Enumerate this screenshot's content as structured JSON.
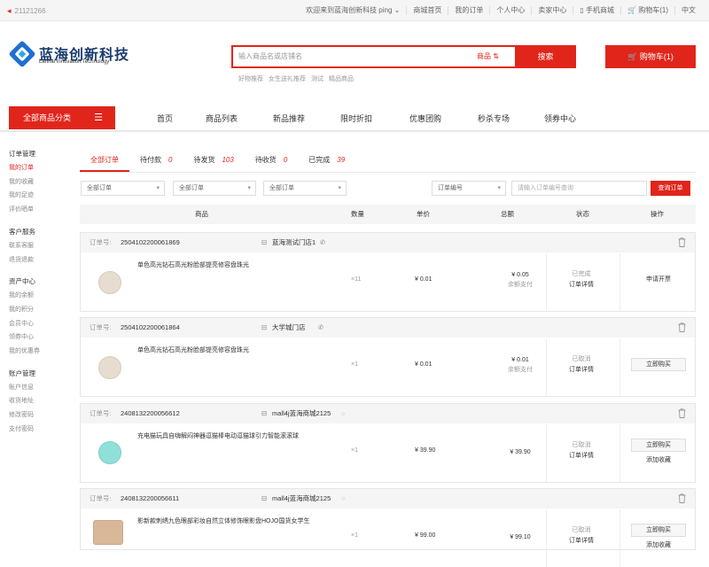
{
  "topbar": {
    "phone": "21121266",
    "welcome": "欢迎来到蓝海创新科技 ping",
    "links": [
      "商城首页",
      "我的订单",
      "个人中心",
      "卖家中心",
      "手机商城",
      "购物车(1)",
      "中文"
    ]
  },
  "logo": {
    "cn": "蓝海创新科技",
    "en": "Lanhai Innovation Technology"
  },
  "search": {
    "placeholder": "输入商品名或店铺名",
    "category": "商品",
    "button": "搜索"
  },
  "hotwords": [
    "好物推荐",
    "女生送礼推荐",
    "测试",
    "精品商品"
  ],
  "cart": {
    "label": "购物车(1)"
  },
  "category_menu": {
    "label": "全部商品分类"
  },
  "nav": [
    "首页",
    "商品列表",
    "新品推荐",
    "限时折扣",
    "优惠团购",
    "秒杀专场",
    "领券中心"
  ],
  "sidebar": [
    {
      "title": "订单管理",
      "items": [
        "我的订单",
        "我的收藏",
        "我的足迹",
        "评价晒单"
      ]
    },
    {
      "title": "客户服务",
      "items": [
        "联系客服",
        "退货退款"
      ]
    },
    {
      "title": "资产中心",
      "items": [
        "我的余额",
        "我的积分",
        "会员中心",
        "领券中心",
        "我的优惠券"
      ]
    },
    {
      "title": "账户管理",
      "items": [
        "账户信息",
        "收货地址",
        "修改密码",
        "支付密码"
      ]
    }
  ],
  "tabs": [
    {
      "label": "全部订单",
      "count": ""
    },
    {
      "label": "待付款",
      "count": "0"
    },
    {
      "label": "待发货",
      "count": "103"
    },
    {
      "label": "待收货",
      "count": "0"
    },
    {
      "label": "已完成",
      "count": "39"
    }
  ],
  "filters": {
    "select1": "全部订单",
    "select2": "全部订单",
    "select3": "全部订单",
    "select4": "订单编号",
    "input_placeholder": "请输入订单编号查询",
    "query_button": "查询订单"
  },
  "table_headers": [
    "商品",
    "数量",
    "单价",
    "总额",
    "状态",
    "操作"
  ],
  "order_no_label": "订单号:",
  "orders": [
    {
      "order_no": "2504102200061869",
      "store": "蓝海测试门店1",
      "product": "单色高光钻石高光粉脸部提亮修容盘珠光",
      "qty": "×11",
      "price": "¥ 0.01",
      "total": "¥ 0.05",
      "pay_method": "余额支付",
      "status": "已完成",
      "detail": "订单详情",
      "action1": "申请开票",
      "action2": "",
      "img_color": "#e6ddd0"
    },
    {
      "order_no": "2504102200061864",
      "store": "大学城门店",
      "product": "单色高光钻石高光粉脸部提亮修容盘珠光",
      "qty": "×1",
      "price": "¥ 0.01",
      "total": "¥ 0.01",
      "pay_method": "余额支付",
      "status": "已取消",
      "detail": "订单详情",
      "action1": "立即购买",
      "action2": "",
      "img_color": "#e6ddd0"
    },
    {
      "order_no": "2408132200056612",
      "store": "mall4j蓝海商城2125",
      "product": "充电猫玩具自嗨解闷神器逗猫棒电动逗猫球引力智能滚滚球",
      "qty": "×1",
      "price": "¥ 39.90",
      "total": "¥ 39.90",
      "pay_method": "",
      "status": "已取消",
      "detail": "订单详情",
      "action1": "立即购买",
      "action2": "添加收藏",
      "img_color": "#8fe0d8"
    },
    {
      "order_no": "2408132200056611",
      "store": "mall4j蓝海商城2125",
      "product": "影新款刺绣九色眼部彩妆自然立体修饰眼影盘HOJO国货女学生",
      "qty": "×1",
      "price": "¥ 99.00",
      "total": "¥ 99.10",
      "pay_method": "",
      "status": "已取消",
      "detail": "订单详情",
      "action1": "立即购买",
      "action2": "添加收藏",
      "img_color": "#d9b89a"
    }
  ]
}
